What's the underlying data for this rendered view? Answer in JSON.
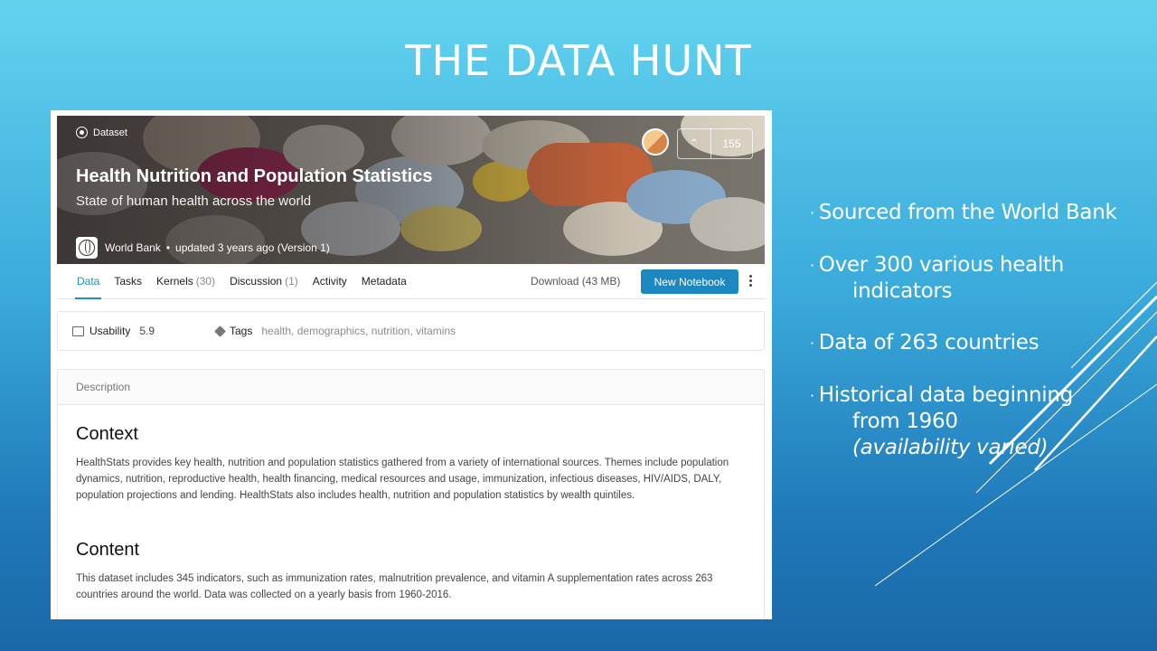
{
  "slide": {
    "title": "THE DATA HUNT",
    "bullets": [
      {
        "text": "Sourced from the World Bank"
      },
      {
        "text": "Over 300 various health",
        "cont": "indicators"
      },
      {
        "text": "Data of 263 countries"
      },
      {
        "text": "Historical data beginning",
        "cont": "from 1960",
        "cont2": "(availability varied)"
      }
    ]
  },
  "dataset": {
    "kind_label": "Dataset",
    "title": "Health Nutrition and Population Statistics",
    "subtitle": "State of human health across the world",
    "owner": "World Bank",
    "updated": "updated 3 years ago (Version 1)",
    "votes": "155",
    "tabs": [
      {
        "label": "Data"
      },
      {
        "label": "Tasks"
      },
      {
        "label": "Kernels",
        "count": "(30)"
      },
      {
        "label": "Discussion",
        "count": "(1)"
      },
      {
        "label": "Activity"
      },
      {
        "label": "Metadata"
      }
    ],
    "download_label": "Download (43 MB)",
    "new_notebook_label": "New Notebook",
    "usability_label": "Usability",
    "usability_value": "5.9",
    "tags_label": "Tags",
    "tags": [
      "health",
      "demographics",
      "nutrition",
      "vitamins"
    ],
    "tags_text": "health, demographics, nutrition, vitamins",
    "description_header": "Description",
    "context_heading": "Context",
    "context_text": "HealthStats provides key health, nutrition and population statistics gathered from a variety of international sources. Themes include population dynamics, nutrition, reproductive health, health financing, medical resources and usage, immunization, infectious diseases, HIV/AIDS, DALY, population projections and lending. HealthStats also includes health, nutrition and population statistics by wealth quintiles.",
    "content_heading": "Content",
    "content_text": "This dataset includes 345 indicators, such as immunization rates, malnutrition prevalence, and vitamin A supplementation rates across 263 countries around the world. Data was collected on a yearly basis from 1960-2016."
  },
  "colors": {
    "accent": "#1c87c0",
    "active_tab": "#1f8ec0"
  }
}
